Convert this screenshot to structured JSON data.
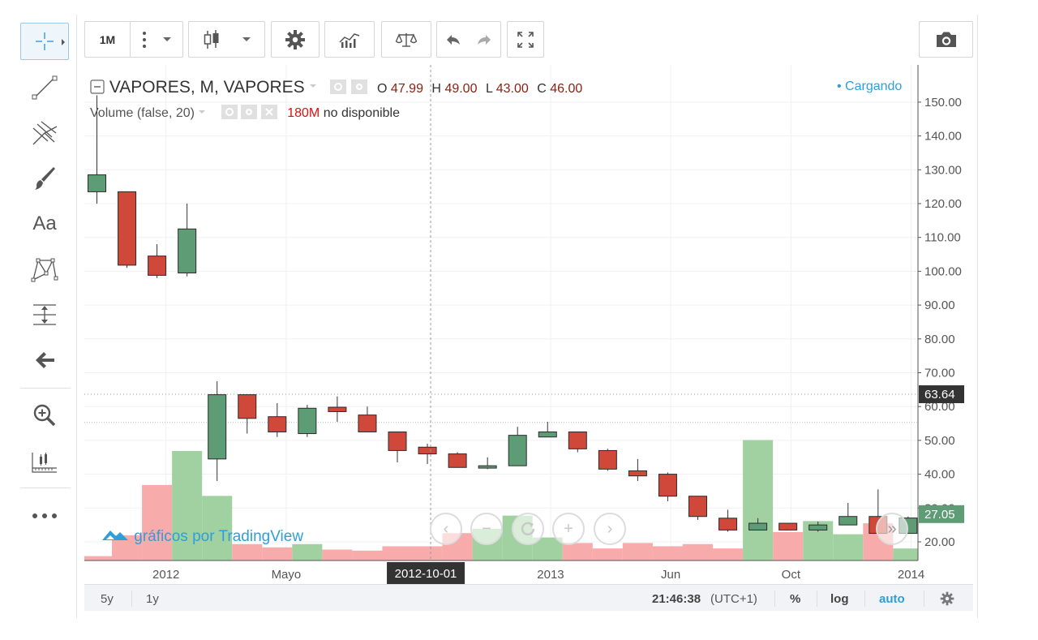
{
  "toolbar": {
    "interval": "1M"
  },
  "legend": {
    "symbol": "VAPORES, M, VAPORES",
    "o_label": "O",
    "o_value": "47.99",
    "h_label": "H",
    "h_value": "49.00",
    "l_label": "L",
    "l_value": "43.00",
    "c_label": "C",
    "c_value": "46.00",
    "volume_title": "Volume (false, 20)",
    "volume_value": "180M",
    "volume_status": "no disponible",
    "loading": "• Cargando"
  },
  "watermark": "gráficos por TradingView",
  "bottom": {
    "range_5y": "5y",
    "range_1y": "1y",
    "time": "21:46:38",
    "timezone": "(UTC+1)",
    "percent": "%",
    "log": "log",
    "auto": "auto"
  },
  "crosshair_label": "2012-10-01",
  "colors": {
    "up": "#5e9c76",
    "down": "#d0483a",
    "vol_up": "#9ccf9c",
    "vol_down": "#f7a6a6",
    "accent": "#2e9fd8",
    "last_price_bg": "#5e9c76"
  },
  "chart_data": {
    "type": "candlestick",
    "y_ticks": [
      20,
      30,
      40,
      50,
      60,
      70,
      80,
      90,
      100,
      110,
      120,
      130,
      140,
      150
    ],
    "y_tick_labels": [
      "20.00",
      "30.00",
      "40.00",
      "50.00",
      "60.00",
      "70.00",
      "80.00",
      "90.00",
      "100.00",
      "110.00",
      "120.00",
      "130.00",
      "140.00",
      "150.00"
    ],
    "x_labels": [
      "2012",
      "Mayo",
      "2013",
      "Jun",
      "Oct",
      "2014"
    ],
    "last_price": "27.05",
    "crosshair_price": "63.64",
    "candles": [
      {
        "date": "2011-11",
        "o": 123.5,
        "h": 152,
        "l": 120,
        "c": 128.5
      },
      {
        "date": "2011-12",
        "o": 123.5,
        "h": 123.5,
        "l": 101,
        "c": 101.8
      },
      {
        "date": "2012-01",
        "o": 104.5,
        "h": 108,
        "l": 98,
        "c": 98.8
      },
      {
        "date": "2012-02",
        "o": 99.5,
        "h": 120,
        "l": 98.5,
        "c": 112.5
      },
      {
        "date": "2012-03",
        "o": 44.5,
        "h": 67.5,
        "l": 38,
        "c": 63.5
      },
      {
        "date": "2012-04",
        "o": 63.5,
        "h": 63.5,
        "l": 52,
        "c": 56.5
      },
      {
        "date": "2012-05",
        "o": 57,
        "h": 61,
        "l": 51,
        "c": 52.5
      },
      {
        "date": "2012-06",
        "o": 52,
        "h": 60.5,
        "l": 51,
        "c": 59.5
      },
      {
        "date": "2012-07",
        "o": 59.8,
        "h": 63,
        "l": 55.5,
        "c": 58.5
      },
      {
        "date": "2012-08",
        "o": 57.5,
        "h": 60,
        "l": 52.5,
        "c": 52.5
      },
      {
        "date": "2012-09",
        "o": 52.5,
        "h": 52.5,
        "l": 43.5,
        "c": 47
      },
      {
        "date": "2012-10",
        "o": 47.99,
        "h": 49,
        "l": 43,
        "c": 46
      },
      {
        "date": "2012-11",
        "o": 46,
        "h": 46.5,
        "l": 42,
        "c": 42
      },
      {
        "date": "2012-12",
        "o": 41.8,
        "h": 45,
        "l": 41.5,
        "c": 42.5
      },
      {
        "date": "2013-01",
        "o": 42.5,
        "h": 54,
        "l": 42.5,
        "c": 51.5
      },
      {
        "date": "2013-02",
        "o": 51,
        "h": 55.5,
        "l": 51,
        "c": 52.5
      },
      {
        "date": "2013-03",
        "o": 52.5,
        "h": 52.5,
        "l": 46.5,
        "c": 47.5
      },
      {
        "date": "2013-04",
        "o": 47,
        "h": 47.5,
        "l": 41,
        "c": 41.5
      },
      {
        "date": "2013-05",
        "o": 41,
        "h": 44.5,
        "l": 38,
        "c": 39.5
      },
      {
        "date": "2013-06",
        "o": 40,
        "h": 40.5,
        "l": 32,
        "c": 33.5
      },
      {
        "date": "2013-07",
        "o": 33.5,
        "h": 33.5,
        "l": 26.5,
        "c": 27.5
      },
      {
        "date": "2013-08",
        "o": 27,
        "h": 29.5,
        "l": 23,
        "c": 23.5
      },
      {
        "date": "2013-09",
        "o": 23.5,
        "h": 27,
        "l": 23.5,
        "c": 25.5
      },
      {
        "date": "2013-10",
        "o": 25.5,
        "h": 25.5,
        "l": 23.5,
        "c": 23.5
      },
      {
        "date": "2013-11",
        "o": 23.5,
        "h": 26,
        "l": 23,
        "c": 25
      },
      {
        "date": "2013-12",
        "o": 25,
        "h": 31.5,
        "l": 25,
        "c": 27.5
      },
      {
        "date": "2014-01",
        "o": 27.5,
        "h": 35.5,
        "l": 21.5,
        "c": 22.5
      },
      {
        "date": "2014-02",
        "o": 22.5,
        "h": 27.5,
        "l": 22.5,
        "c": 27.05
      }
    ],
    "volume_relative": [
      0.04,
      0.23,
      0.69,
      1.0,
      0.59,
      0.15,
      0.12,
      0.15,
      0.1,
      0.09,
      0.13,
      0.13,
      0.25,
      0.29,
      0.41,
      0.21,
      0.16,
      0.11,
      0.16,
      0.13,
      0.15,
      0.11,
      1.1,
      0.26,
      0.36,
      0.24,
      0.34,
      0.11
    ],
    "volume_direction": [
      "down",
      "down",
      "down",
      "up",
      "up",
      "down",
      "down",
      "up",
      "down",
      "down",
      "down",
      "down",
      "down",
      "up",
      "up",
      "up",
      "down",
      "down",
      "down",
      "down",
      "down",
      "down",
      "up",
      "down",
      "up",
      "up",
      "down",
      "up"
    ]
  }
}
